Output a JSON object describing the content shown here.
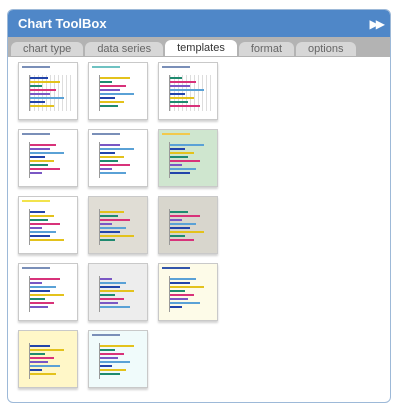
{
  "header": {
    "title": "Chart ToolBox",
    "collapse_icon": "double-chevron-right-icon"
  },
  "tabs": [
    {
      "label": "chart type",
      "active": false
    },
    {
      "label": "data series",
      "active": false
    },
    {
      "label": "templates",
      "active": true
    },
    {
      "label": "format",
      "active": false
    },
    {
      "label": "options",
      "active": false
    }
  ],
  "colors": {
    "header_bg": "#4f87c8",
    "tabbar_bg": "#b3b3b3",
    "series": [
      "#2244aa",
      "#e3c21c",
      "#1f8a6f",
      "#d8327a",
      "#7a57c4",
      "#5aa1d6"
    ]
  },
  "templates": [
    {
      "style": "plain-grid",
      "bg": "#ffffff",
      "title_bg": "#ffffff"
    },
    {
      "style": "teal-bar",
      "bg": "#ffffff",
      "title_bg": "#6fc2c2"
    },
    {
      "style": "blue-grid",
      "bg": "#ffffff",
      "title_bg": "#ffffff"
    },
    {
      "style": "plain",
      "bg": "#ffffff",
      "title_bg": "#ffffff"
    },
    {
      "style": "plain",
      "bg": "#ffffff",
      "title_bg": "#ffffff"
    },
    {
      "style": "green",
      "bg": "#cfe6cf",
      "title_bg": "#f2c94c"
    },
    {
      "style": "yellow-banner",
      "bg": "#ffffff",
      "title_bg": "#f2e34c"
    },
    {
      "style": "gray",
      "bg": "#e0ddd5",
      "title_bg": "#e0ddd5"
    },
    {
      "style": "gray-dark",
      "bg": "#d8d6cd",
      "title_bg": "#d8d6cd"
    },
    {
      "style": "dots",
      "bg": "#ffffff",
      "title_bg": "#ffffff"
    },
    {
      "style": "light-gray",
      "bg": "#ededed",
      "title_bg": "#ededed"
    },
    {
      "style": "cream",
      "bg": "#fdfbe8",
      "title_bg": "#3355aa"
    },
    {
      "style": "light-yellow",
      "bg": "#fff7c8",
      "title_bg": "#fff7c8"
    },
    {
      "style": "mint",
      "bg": "#f0fbfb",
      "title_bg": "#ffffff"
    }
  ]
}
